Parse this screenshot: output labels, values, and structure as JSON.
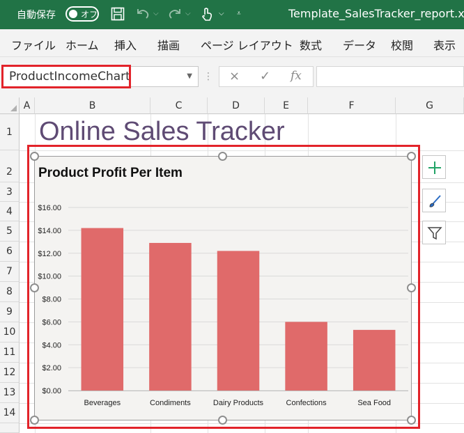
{
  "titlebar": {
    "autosave_label": "自動保存",
    "autosave_state": "オフ",
    "filename": "Template_SalesTracker_report.xlsx",
    "bg_color": "#217346"
  },
  "ribbon": {
    "tabs": [
      {
        "label": "ファイル"
      },
      {
        "label": "ホーム"
      },
      {
        "label": "挿入"
      },
      {
        "label": "描画"
      },
      {
        "label": "ページ レイアウト"
      },
      {
        "label": "数式"
      },
      {
        "label": "データ"
      },
      {
        "label": "校閲"
      },
      {
        "label": "表示"
      }
    ]
  },
  "formula_bar": {
    "name_box_value": "ProductIncomeChart",
    "cancel_icon": "×",
    "enter_icon": "✓",
    "fx_icon": "fx",
    "formula_value": ""
  },
  "grid": {
    "columns": [
      "A",
      "B",
      "C",
      "D",
      "E",
      "F",
      "G"
    ],
    "rows": [
      "1",
      "2",
      "3",
      "4",
      "5",
      "6",
      "7",
      "8",
      "9",
      "10",
      "11",
      "12",
      "13",
      "14"
    ]
  },
  "sheet": {
    "title": "Online Sales Tracker",
    "title_color": "#5f4b74"
  },
  "chart_data": {
    "type": "bar",
    "title": "Product Profit Per Item",
    "categories": [
      "Beverages",
      "Condiments",
      "Dairy Products",
      "Confections",
      "Sea Food"
    ],
    "values": [
      14.2,
      12.9,
      12.2,
      6.0,
      5.3
    ],
    "y_ticks": [
      "$0.00",
      "$2.00",
      "$4.00",
      "$6.00",
      "$8.00",
      "$10.00",
      "$12.00",
      "$14.00",
      "$16.00"
    ],
    "ylim": [
      0,
      16
    ],
    "xlabel": "",
    "ylabel": "",
    "grid": true,
    "bar_color": "#e06a6a"
  },
  "chart_tools": {
    "icons": [
      "chart-elements-plus-icon",
      "chart-styles-brush-icon",
      "chart-filters-funnel-icon"
    ]
  },
  "highlight_color": "#e2232a"
}
